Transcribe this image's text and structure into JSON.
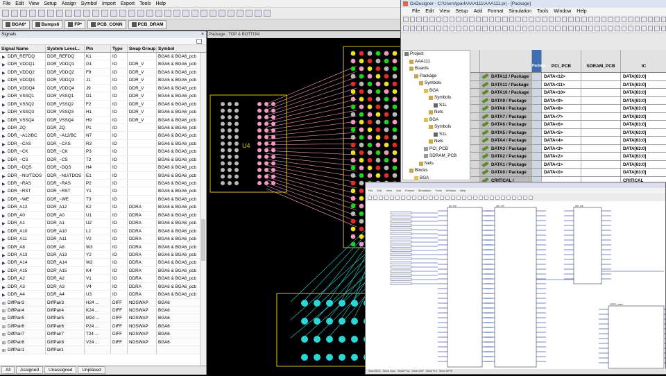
{
  "menubar": {
    "items": [
      "File",
      "Edit",
      "View",
      "Setup",
      "Assign",
      "Symbol",
      "Import",
      "Export",
      "Tools",
      "Help"
    ]
  },
  "tabs": [
    {
      "label": "BGA6*"
    },
    {
      "label": "Bumps6"
    },
    {
      "label": "FP*"
    },
    {
      "label": "PCB_CONN"
    },
    {
      "label": "PCB_DRAM"
    }
  ],
  "signals": {
    "title": "Signals",
    "close": "×",
    "headers": [
      "Signal Name",
      "System Level...",
      "Pin",
      "Type",
      "Swap Group",
      "Symbol"
    ],
    "rows": [
      [
        "DDR_REFDQ",
        "DDR_REFDQ",
        "K1",
        "IO",
        "",
        "BGA6 & BGA6_pcb"
      ],
      [
        "DDR_VDDQ1",
        "DDR_VDDQ1",
        "G1",
        "IO",
        "DDR_V",
        "BGA6 & BGA6_pcb"
      ],
      [
        "DDR_VDDQ2",
        "DDR_VDDQ2",
        "F9",
        "IO",
        "DDR_V",
        "BGA6 & BGA6_pcb"
      ],
      [
        "DDR_VDDQ3",
        "DDR_VDDQ3",
        "J1",
        "IO",
        "DDR_V",
        "BGA6 & BGA6_pcb"
      ],
      [
        "DDR_VDDQ4",
        "DDR_VDDQ4",
        "J9",
        "IO",
        "DDR_V",
        "BGA6 & BGA6_pcb"
      ],
      [
        "DDR_VSSQ1",
        "DDR_VSSQ1",
        "D1",
        "IO",
        "DDR_V",
        "BGA6 & BGA6_pcb"
      ],
      [
        "DDR_VSSQ2",
        "DDR_VSSQ2",
        "F2",
        "IO",
        "DDR_V",
        "BGA6 & BGA6_pcb"
      ],
      [
        "DDR_VSSQ3",
        "DDR_VSSQ3",
        "H1",
        "IO",
        "DDR_V",
        "BGA6 & BGA6_pcb"
      ],
      [
        "DDR_VSSQ4",
        "DDR_VSSQ4",
        "H9",
        "IO",
        "DDR_V",
        "BGA6 & BGA6_pcb"
      ],
      [
        "DDR_ZQ",
        "DDR_ZQ",
        "P1",
        "IO",
        "",
        "BGA6 & BGA6_pcb"
      ],
      [
        "DDR_~A12/BC",
        "DDR_~A12/BC",
        "N7",
        "IO",
        "",
        "BGA6 & BGA6_pcb"
      ],
      [
        "DDR_~CAS",
        "DDR_~CAS",
        "R3",
        "IO",
        "",
        "BGA6 & BGA6_pcb"
      ],
      [
        "DDR_~CK",
        "DDR_~CK",
        "P3",
        "IO",
        "",
        "BGA6 & BGA6_pcb"
      ],
      [
        "DDR_~CS",
        "DDR_~CS",
        "T2",
        "IO",
        "",
        "BGA6 & BGA6_pcb"
      ],
      [
        "DDR_~DQS",
        "DDR_~DQS",
        "H4",
        "IO",
        "",
        "BGA6 & BGA6_pcb"
      ],
      [
        "DDR_~NU/TDOS",
        "DDR_~NU/TDOS",
        "E1",
        "IO",
        "",
        "BGA6 & BGA6_pcb"
      ],
      [
        "DDR_~RAS",
        "DDR_~RAS",
        "P2",
        "IO",
        "",
        "BGA6 & BGA6_pcb"
      ],
      [
        "DDR_~RST",
        "DDR_~RST",
        "Y1",
        "IO",
        "",
        "BGA6 & BGA6_pcb"
      ],
      [
        "DDR_~WE",
        "DDR_~WE",
        "T3",
        "IO",
        "",
        "BGA6 & BGA6_pcb"
      ],
      [
        "DDR_A12",
        "DDR_A12",
        "K2",
        "IO",
        "DDRA",
        "BGA6 & BGA6_pcb"
      ],
      [
        "DDR_A0",
        "DDR_A0",
        "U1",
        "IO",
        "DDRA",
        "BGA6 & BGA6_pcb"
      ],
      [
        "DDR_A1",
        "DDR_A1",
        "U2",
        "IO",
        "DDRA",
        "BGA6 & BGA6_pcb"
      ],
      [
        "DDR_A10",
        "DDR_A10",
        "L2",
        "IO",
        "DDRA",
        "BGA6 & BGA6_pcb"
      ],
      [
        "DDR_A11",
        "DDR_A11",
        "V2",
        "IO",
        "DDRA",
        "BGA6 & BGA6_pcb"
      ],
      [
        "DDR_A8",
        "DDR_A8",
        "W3",
        "IO",
        "DDRA",
        "BGA6 & BGA6_pcb"
      ],
      [
        "DDR_A13",
        "DDR_A13",
        "Y2",
        "IO",
        "DDRA",
        "BGA6 & BGA6_pcb"
      ],
      [
        "DDR_A14",
        "DDR_A14",
        "W2",
        "IO",
        "DDRA",
        "BGA6 & BGA6_pcb"
      ],
      [
        "DDR_A15",
        "DDR_A15",
        "K4",
        "IO",
        "DDRA",
        "BGA6 & BGA6_pcb"
      ],
      [
        "DDR_A2",
        "DDR_A2",
        "V1",
        "IO",
        "DDRA",
        "BGA6 & BGA6_pcb"
      ],
      [
        "DDR_A3",
        "DDR_A3",
        "V4",
        "IO",
        "DDRA",
        "BGA6 & BGA6_pcb"
      ],
      [
        "DDR_A4",
        "DDR_A4",
        "U3",
        "IO",
        "DDRA",
        "BGA6 & BGA6_pcb"
      ],
      [
        "DiffPair3",
        "DiffPair3",
        "H24 ...",
        "DIFF",
        "NOSWAP",
        "BGA6"
      ],
      [
        "DiffPair4",
        "DiffPair4",
        "K24 ...",
        "DIFF",
        "NOSWAP",
        "BGA6"
      ],
      [
        "DiffPair5",
        "DiffPair5",
        "M24 ...",
        "DIFF",
        "NOSWAP",
        "BGA6"
      ],
      [
        "DiffPair6",
        "DiffPair6",
        "P24 ...",
        "DIFF",
        "NOSWAP",
        "BGA6"
      ],
      [
        "DiffPair7",
        "DiffPair7",
        "T24 ...",
        "DIFF",
        "NOSWAP",
        "BGA6"
      ],
      [
        "DiffPair8",
        "DiffPair8",
        "V24 ...",
        "DIFF",
        "NOSWAP",
        "BGA6"
      ],
      [
        "DiffPair1",
        "DiffPair1",
        "",
        "",
        "",
        ""
      ]
    ],
    "bottom_tabs": [
      "All",
      "Assigned",
      "Unassigned",
      "Unplaced"
    ]
  },
  "package_view": {
    "title": "Package : TOP & BOTTOM",
    "ref_des": "U4",
    "colors": {
      "pink": "#f29ac2",
      "grey": "#b9b9b9",
      "yellow": "#e9e12a",
      "green": "#1fd21f",
      "red": "#e22b2b",
      "cyan": "#2bd6d6",
      "outline": "#d8c21a"
    }
  },
  "dxdesigner": {
    "title": "DxDesigner - C:\\Users\\jpark\\AAA111\\AAA111.prj - [Package]",
    "menu": [
      "File",
      "Edit",
      "View",
      "Setup",
      "Add",
      "Format",
      "Simulation",
      "Tools",
      "Window",
      "Help"
    ],
    "tree": [
      {
        "label": "Project",
        "indent": 0,
        "color": "#7a7a7a"
      },
      {
        "label": "AAA111",
        "indent": 1,
        "color": "#caa84a"
      },
      {
        "label": "Boards",
        "indent": 1,
        "color": "#caa84a"
      },
      {
        "label": "Package",
        "indent": 2,
        "color": "#caa84a"
      },
      {
        "label": "Symbols",
        "indent": 3,
        "color": "#caa84a"
      },
      {
        "label": "BGA",
        "indent": 4,
        "color": "#e3c24a"
      },
      {
        "label": "Symbols",
        "indent": 5,
        "color": "#caa84a"
      },
      {
        "label": "S1L",
        "indent": 6,
        "color": "#666"
      },
      {
        "label": "Nets",
        "indent": 5,
        "color": "#caa84a"
      },
      {
        "label": "BGA",
        "indent": 4,
        "color": "#e3c24a"
      },
      {
        "label": "Symbols",
        "indent": 5,
        "color": "#caa84a"
      },
      {
        "label": "S1L",
        "indent": 6,
        "color": "#666"
      },
      {
        "label": "Nets",
        "indent": 5,
        "color": "#caa84a"
      },
      {
        "label": "PCI_PCB",
        "indent": 4,
        "color": "#999"
      },
      {
        "label": "SDRAM_PCB",
        "indent": 4,
        "color": "#999"
      },
      {
        "label": "Nets",
        "indent": 3,
        "color": "#caa84a"
      },
      {
        "label": "Blocks",
        "indent": 1,
        "color": "#caa84a"
      },
      {
        "label": "BGA",
        "indent": 2,
        "color": "#e3c24a"
      }
    ],
    "grid_headers": [
      "PCI_PCB",
      "SDRAM_PCB",
      "IC"
    ],
    "grid_header_tag": "Package",
    "grid_rows": [
      [
        "DATA12 / Package",
        "DATA<12>",
        "",
        "DATA[63:0]"
      ],
      [
        "DATA11 / Package",
        "DATA<11>",
        "",
        "DATA[63:0]"
      ],
      [
        "DATA10 / Package",
        "DATA<10>",
        "",
        "DATA[63:0]"
      ],
      [
        "DATA9 / Package",
        "DATA<9>",
        "",
        "DATA[63:0]"
      ],
      [
        "DATA8 / Package",
        "DATA<8>",
        "",
        "DATA[63:0]"
      ],
      [
        "DATA7 / Package",
        "DATA<7>",
        "",
        "DATA[63:0]"
      ],
      [
        "DATA6 / Package",
        "DATA<6>",
        "",
        "DATA[63:0]"
      ],
      [
        "DATA5 / Package",
        "DATA<5>",
        "",
        "DATA[63:0]"
      ],
      [
        "DATA4 / Package",
        "DATA<4>",
        "",
        "DATA[63:0]"
      ],
      [
        "DATA3 / Package",
        "DATA<3>",
        "",
        "DATA[63:0]"
      ],
      [
        "DATA2 / Package",
        "DATA<2>",
        "",
        "DATA[63:0]"
      ],
      [
        "DATA1 / Package",
        "DATA<1>",
        "",
        "DATA[63:0]"
      ],
      [
        "DATA0 / Package",
        "DATA<0>",
        "",
        "DATA[63:0]"
      ],
      [
        "CRITICAL / Package",
        "",
        "",
        "CRITICAL"
      ]
    ]
  },
  "schematic": {
    "title": "",
    "menu": [
      "File",
      "Edit",
      "View",
      "Add",
      "Format",
      "Simulation",
      "Tools",
      "Window",
      "Help"
    ],
    "bottom_tabs": [
      "Sheet BCG",
      "Sheet Conn",
      "Sheet Proc",
      "Sheet DSP",
      "Sheet PCI",
      "Sheet MFTE"
    ],
    "blocks": [
      {
        "name": "pci_top"
      },
      {
        "name": "ddr_ctrl"
      },
      {
        "name": "ddr_top"
      },
      {
        "name": "DDR2_mem"
      }
    ]
  }
}
